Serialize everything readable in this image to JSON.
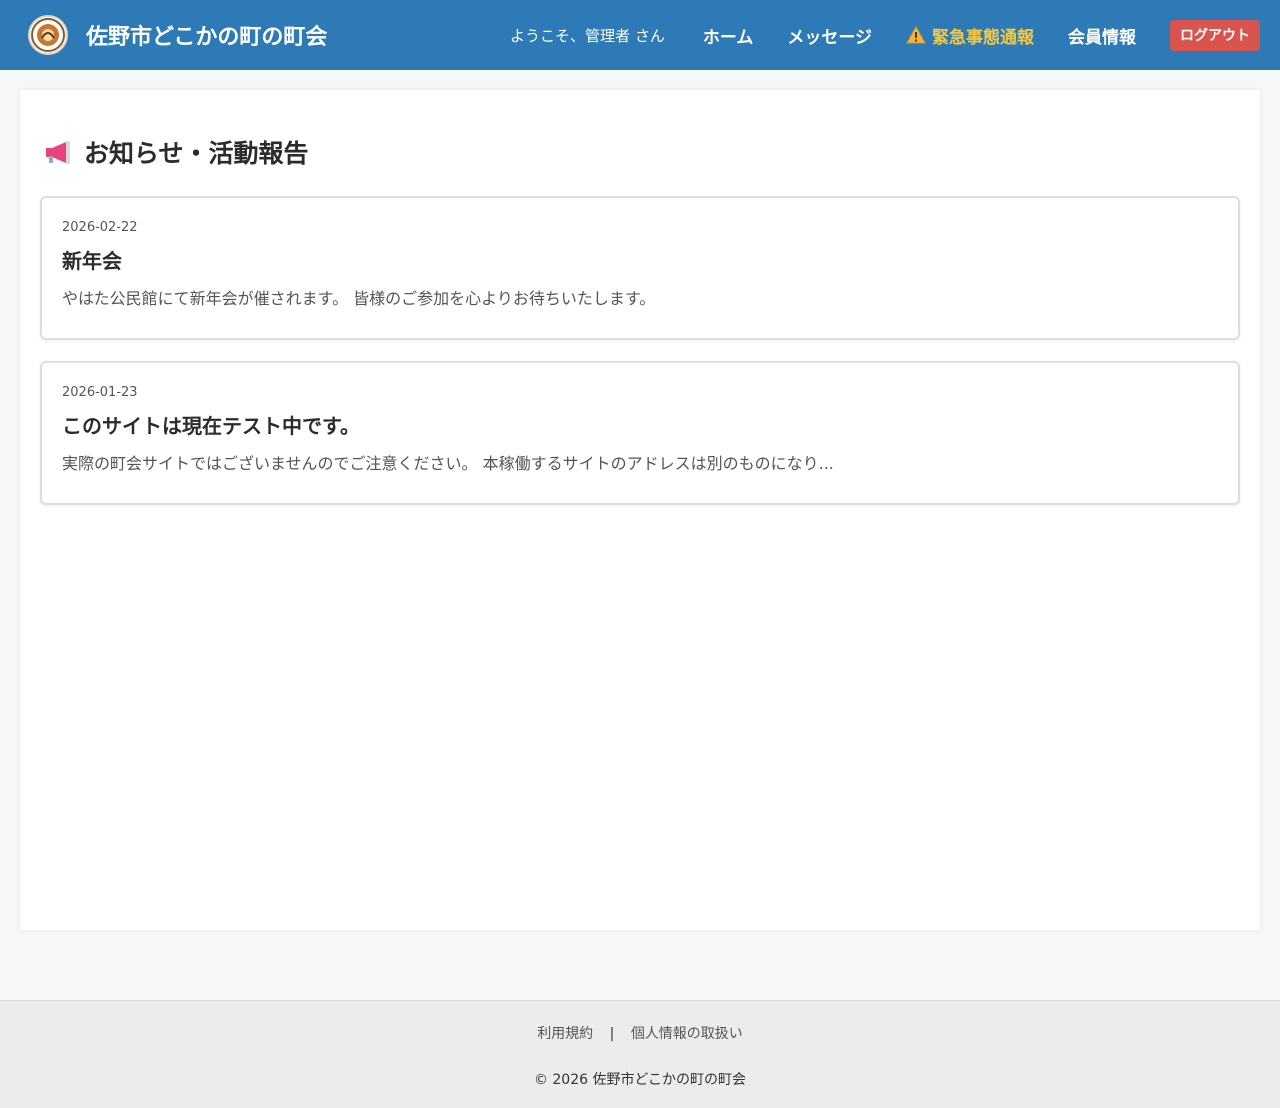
{
  "header": {
    "site_title": "佐野市どこかの町の町会",
    "welcome_text": "ようこそ、管理者 さん",
    "nav": {
      "home": "ホーム",
      "messages": "メッセージ",
      "emergency": "緊急事態通報",
      "member_info": "会員情報",
      "logout": "ログアウト"
    },
    "colors": {
      "header_bg": "#2d7ab6",
      "emergency": "#f4c842",
      "logout_bg": "#d9534f"
    }
  },
  "main": {
    "section_title": "お知らせ・活動報告",
    "section_icon": "megaphone-icon",
    "news": [
      {
        "date": "2026-02-22",
        "title": "新年会",
        "body": "やはた公民館にて新年会が催されます。 皆様のご参加を心よりお待ちいたします。"
      },
      {
        "date": "2026-01-23",
        "title": "このサイトは現在テスト中です。",
        "body": "実際の町会サイトではございませんのでご注意ください。 本稼働するサイトのアドレスは別のものになり..."
      }
    ]
  },
  "footer": {
    "terms": "利用規約",
    "separator": "|",
    "privacy": "個人情報の取扱い",
    "copyright": "© 2026 佐野市どこかの町の町会"
  }
}
